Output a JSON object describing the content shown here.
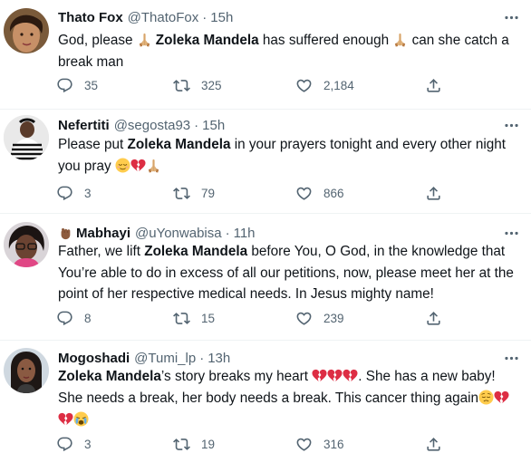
{
  "tweets": [
    {
      "name": "Thato Fox",
      "handle": "@ThatoFox",
      "sep": "·",
      "time": "15h",
      "text": [
        "God, please ",
        "Zoleka Mandela",
        " has suffered enough ",
        " can she catch a break man"
      ],
      "emoji": [
        "folded-hands",
        "folded-hands"
      ],
      "replies": "35",
      "retweets": "325",
      "likes": "2,184"
    },
    {
      "name": "Nefertiti",
      "handle": "@segosta93",
      "sep": "·",
      "time": "15h",
      "text": [
        "Please put ",
        "Zoleka Mandela",
        " in your prayers tonight and every other night you pray "
      ],
      "emoji": [
        "relieved-face",
        "broken-heart",
        "folded-hands"
      ],
      "replies": "3",
      "retweets": "79",
      "likes": "866"
    },
    {
      "name": "Mabhayi",
      "handle": "@uYonwabisa",
      "sep": "·",
      "time": "11h",
      "text": [
        "Father, we lift ",
        "Zoleka Mandela",
        " before You, O God, in the knowledge that You’re able to do in excess of all our petitions, now, please meet her at the point of her respective medical needs. In Jesus mighty name!"
      ],
      "emoji": [
        "raised-fist"
      ],
      "replies": "8",
      "retweets": "15",
      "likes": "239"
    },
    {
      "name": "Mogoshadi",
      "handle": "@Tumi_lp",
      "sep": "·",
      "time": "13h",
      "text": [
        "Zoleka Mandela",
        "’s story breaks my heart ",
        ". She has a new baby! She needs a break, her body needs a break. This cancer thing again"
      ],
      "emoji": [
        "broken-heart",
        "broken-heart",
        "broken-heart",
        "pensive-face",
        "broken-heart",
        "broken-heart",
        "crying-face"
      ],
      "replies": "3",
      "retweets": "19",
      "likes": "316"
    }
  ],
  "icons": [
    "reply-icon",
    "retweet-icon",
    "like-icon",
    "share-icon",
    "more-icon"
  ],
  "colors": {
    "text": "#0f1419",
    "muted": "#536471",
    "divider": "#eff3f4",
    "heart_red": "#dd2e44",
    "skin": "#e0b27a"
  }
}
